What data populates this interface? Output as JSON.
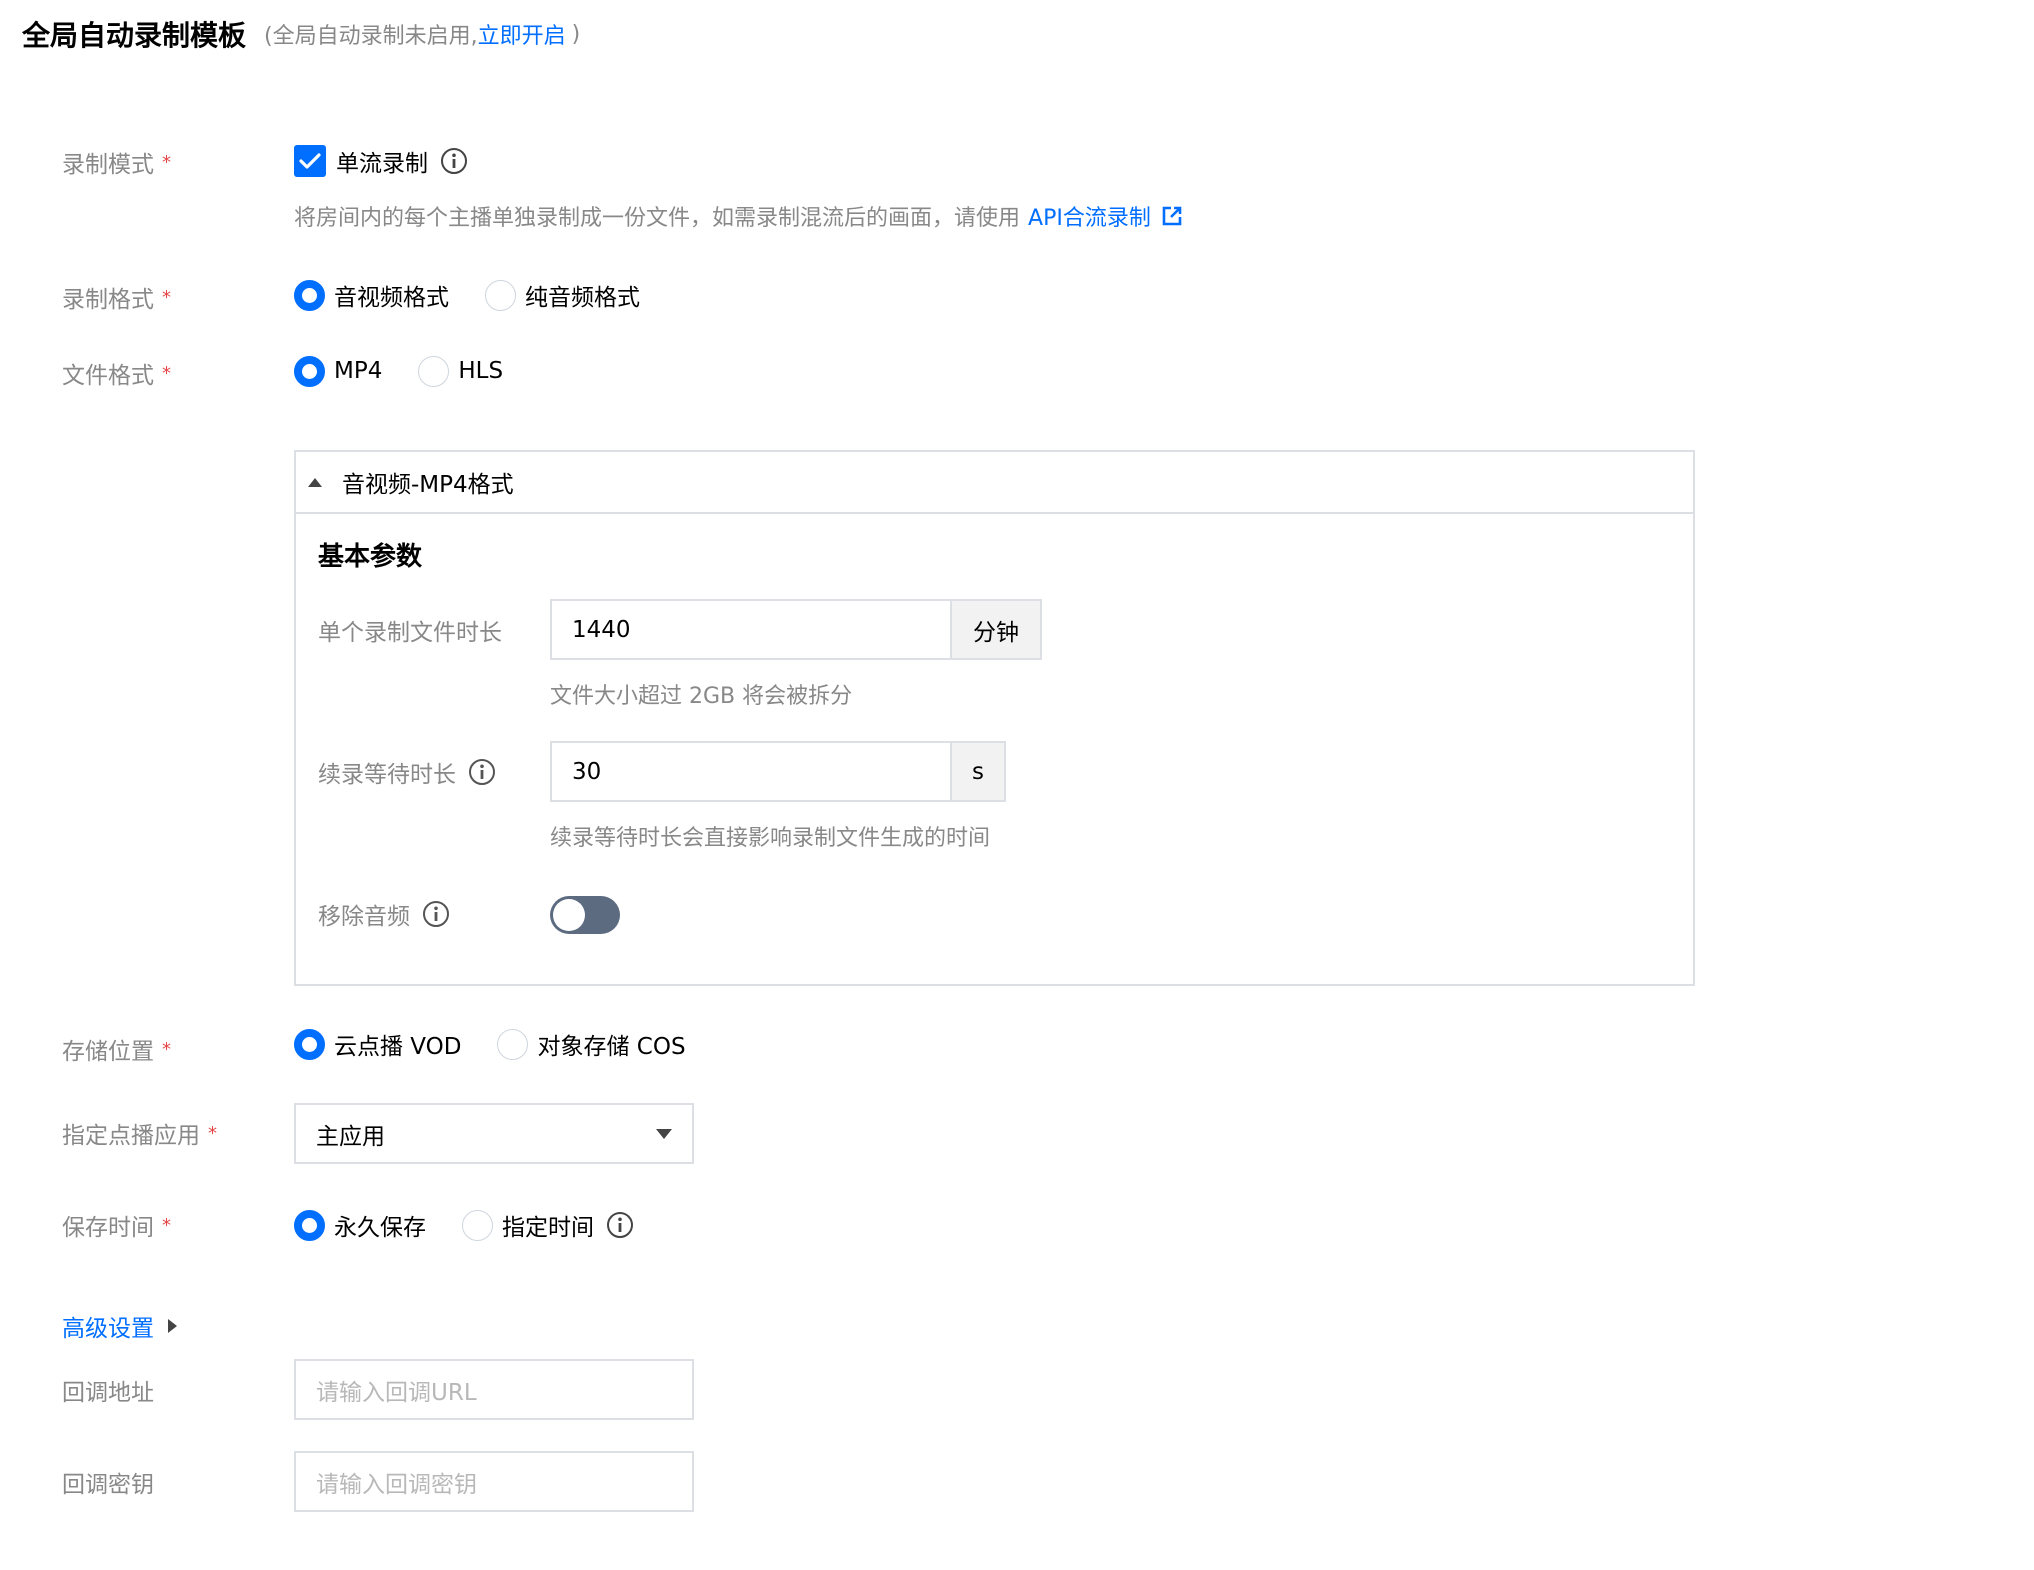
{
  "header": {
    "title": "全局自动录制模板",
    "subtitle": "(全局自动录制未启用, ",
    "enable_link": "立即开启",
    "subtitle_end": ")"
  },
  "record_mode": {
    "label": "录制模式",
    "required": "*",
    "option": "单流录制",
    "checked": true,
    "hint": "将房间内的每个主播单独录制成一份文件，如需录制混流后的画面，请使用",
    "hint_link": "API合流录制"
  },
  "record_format": {
    "label": "录制格式",
    "required": "*",
    "options": [
      "音视频格式",
      "纯音频格式"
    ],
    "selected": "音视频格式"
  },
  "file_format": {
    "label": "文件格式",
    "required": "*",
    "options": [
      "MP4",
      "HLS"
    ],
    "selected": "MP4"
  },
  "panel": {
    "header": "音视频-MP4格式",
    "section_title": "基本参数",
    "duration": {
      "label": "单个录制文件时长",
      "value": "1440",
      "unit": "分钟",
      "hint": "文件大小超过 2GB 将会被拆分"
    },
    "resume_wait": {
      "label": "续录等待时长",
      "value": "30",
      "unit": "s",
      "hint": "续录等待时长会直接影响录制文件生成的时间"
    },
    "remove_audio": {
      "label": "移除音频",
      "enabled": false
    }
  },
  "storage": {
    "label": "存储位置",
    "required": "*",
    "options": [
      "云点播 VOD",
      "对象存储 COS"
    ],
    "selected": "云点播 VOD"
  },
  "vod_app": {
    "label": "指定点播应用",
    "required": "*",
    "selected": "主应用"
  },
  "retention": {
    "label": "保存时间",
    "required": "*",
    "options": [
      "永久保存",
      "指定时间"
    ],
    "selected": "永久保存"
  },
  "advanced": {
    "toggle_label": "高级设置",
    "callback_url": {
      "label": "回调地址",
      "placeholder": "请输入回调URL"
    },
    "callback_key": {
      "label": "回调密钥",
      "placeholder": "请输入回调密钥"
    }
  },
  "colors": {
    "accent": "#006eff",
    "required": "#e54545",
    "label": "#888888",
    "toggle_off": "#5c6b80"
  }
}
